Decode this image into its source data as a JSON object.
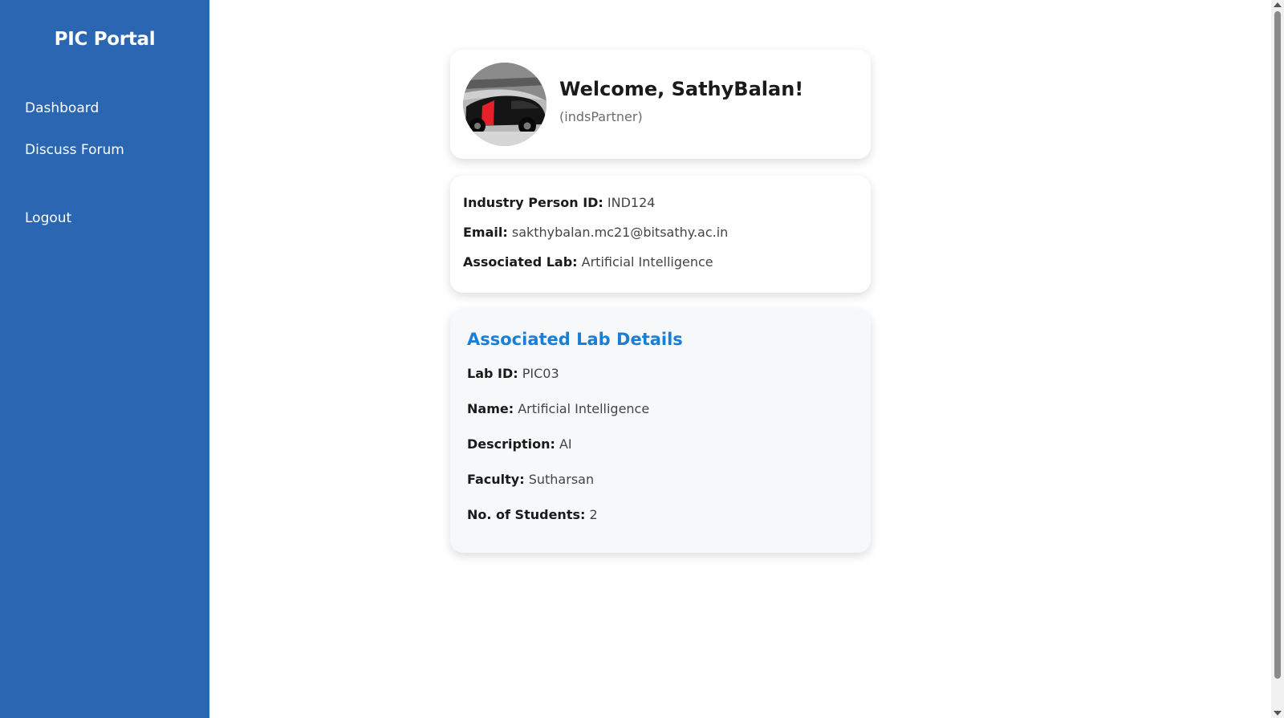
{
  "sidebar": {
    "brand": "PIC Portal",
    "items": [
      {
        "label": "Dashboard"
      },
      {
        "label": "Discuss Forum"
      },
      {
        "label": "Logout"
      }
    ]
  },
  "profile": {
    "welcome": "Welcome, SathyBalan!",
    "role": "(indsPartner)",
    "avatar_icon": "car-photo-avatar"
  },
  "info": {
    "id_label": "Industry Person ID:",
    "id_value": "IND124",
    "email_label": "Email:",
    "email_value": "sakthybalan.mc21@bitsathy.ac.in",
    "lab_label": "Associated Lab:",
    "lab_value": "Artificial Intelligence"
  },
  "lab_details": {
    "title": "Associated Lab Details",
    "rows": [
      {
        "label": "Lab ID:",
        "value": "PIC03"
      },
      {
        "label": "Name:",
        "value": "Artificial Intelligence"
      },
      {
        "label": "Description:",
        "value": "AI"
      },
      {
        "label": "Faculty:",
        "value": "Sutharsan"
      },
      {
        "label": "No. of Students:",
        "value": "2"
      }
    ]
  },
  "colors": {
    "sidebar": "#2a66b1",
    "accent": "#1a7ed6"
  }
}
